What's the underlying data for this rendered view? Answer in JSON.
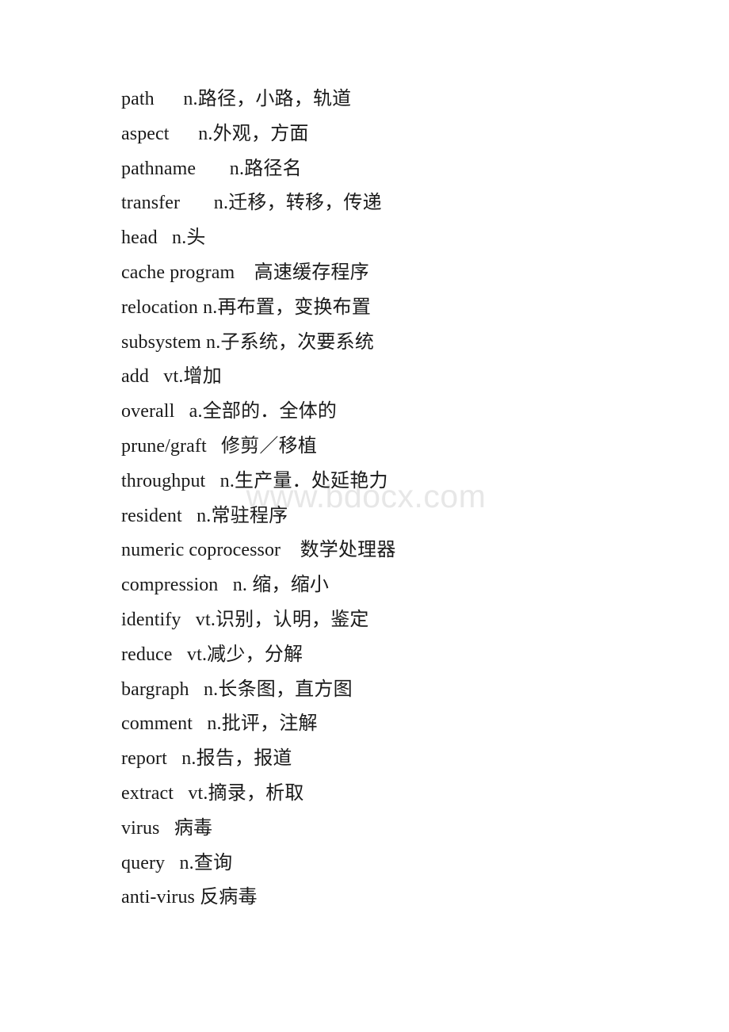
{
  "document": {
    "page_background": "#ffffff",
    "text_color": "#1a1a1a",
    "watermark": {
      "text": "www.bdocx.com",
      "color": "#e7e7e7"
    },
    "entries": [
      {
        "term": "path",
        "gap": "      ",
        "definition": "n.路径，小路，轨道"
      },
      {
        "term": "aspect",
        "gap": "      ",
        "definition": "n.外观，方面"
      },
      {
        "term": "pathname",
        "gap": "       ",
        "definition": "n.路径名"
      },
      {
        "term": "transfer",
        "gap": "       ",
        "definition": "n.迁移，转移，传递"
      },
      {
        "term": "head",
        "gap": "   ",
        "definition": "n.头"
      },
      {
        "term": "cache program",
        "gap": "    ",
        "definition": "高速缓存程序"
      },
      {
        "term": "relocation",
        "gap": " ",
        "definition": "n.再布置，变换布置"
      },
      {
        "term": "subsystem",
        "gap": " ",
        "definition": "n.子系统，次要系统"
      },
      {
        "term": "add",
        "gap": "   ",
        "definition": "vt.增加"
      },
      {
        "term": "overall",
        "gap": "   ",
        "definition": "a.全部的．全体的"
      },
      {
        "term": "prune/graft",
        "gap": "   ",
        "definition": "修剪／移植"
      },
      {
        "term": "throughput",
        "gap": "   ",
        "definition": "n.生产量．处延艳力"
      },
      {
        "term": "resident",
        "gap": "   ",
        "definition": "n.常驻程序"
      },
      {
        "term": "numeric coprocessor",
        "gap": "    ",
        "definition": "数学处理器"
      },
      {
        "term": "compression",
        "gap": "   ",
        "definition": "n. 缩，缩小"
      },
      {
        "term": "identify",
        "gap": "   ",
        "definition": "vt.识别，认明，鉴定"
      },
      {
        "term": "reduce",
        "gap": "   ",
        "definition": "vt.减少，分解"
      },
      {
        "term": "bargraph",
        "gap": "   ",
        "definition": "n.长条图，直方图"
      },
      {
        "term": "comment",
        "gap": "   ",
        "definition": "n.批评，注解"
      },
      {
        "term": "report",
        "gap": "   ",
        "definition": "n.报告，报道"
      },
      {
        "term": "extract",
        "gap": "   ",
        "definition": "vt.摘录，析取"
      },
      {
        "term": "virus",
        "gap": "   ",
        "definition": "病毒"
      },
      {
        "term": "query",
        "gap": "   ",
        "definition": "n.查询"
      },
      {
        "term": "anti-virus",
        "gap": " ",
        "definition": "反病毒"
      }
    ]
  }
}
